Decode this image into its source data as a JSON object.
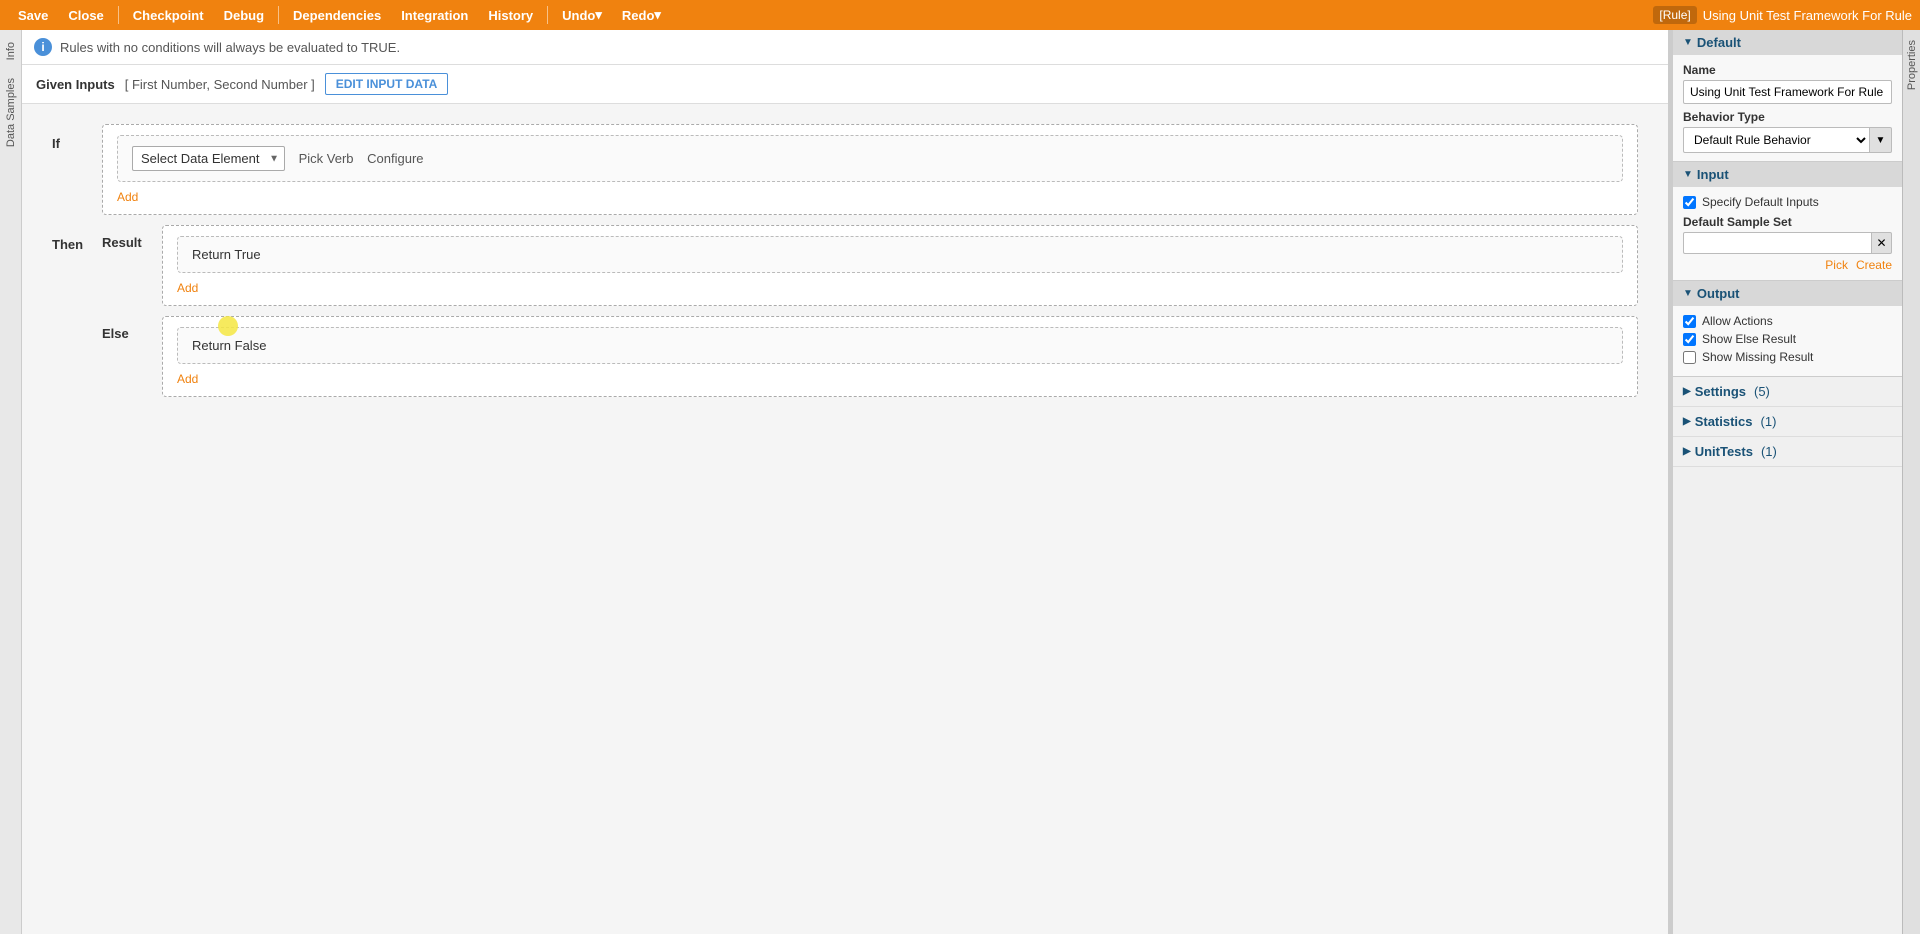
{
  "toolbar": {
    "save_label": "Save",
    "close_label": "Close",
    "checkpoint_label": "Checkpoint",
    "debug_label": "Debug",
    "dependencies_label": "Dependencies",
    "integration_label": "Integration",
    "history_label": "History",
    "undo_label": "Undo",
    "redo_label": "Redo",
    "rule_tag": "[Rule]",
    "breadcrumb_title": "Using Unit Test Framework For Rule"
  },
  "left_tabs": {
    "info_label": "Info",
    "data_samples_label": "Data Samples"
  },
  "info_bar": {
    "message": "Rules with no conditions will always be evaluated to TRUE."
  },
  "inputs_bar": {
    "given_inputs_label": "Given Inputs",
    "inputs_values": "[ First Number, Second Number ]",
    "edit_button_label": "EDIT INPUT DATA"
  },
  "rule": {
    "if_label": "If",
    "then_label": "Then",
    "else_label": "Else",
    "result_label": "Result",
    "select_placeholder": "Select Data Element",
    "pick_verb_label": "Pick Verb",
    "configure_label": "Configure",
    "add_label": "Add",
    "return_true_label": "Return True",
    "return_false_label": "Return False"
  },
  "right_panel": {
    "properties_tab": "Properties",
    "default_section": {
      "header": "Default",
      "name_label": "Name",
      "name_value": "Using Unit Test Framework For Rule",
      "behavior_type_label": "Behavior Type",
      "behavior_type_value": "Default Rule Behavior"
    },
    "input_section": {
      "header": "Input",
      "specify_inputs_label": "Specify Default Inputs",
      "specify_inputs_checked": true,
      "default_sample_set_label": "Default Sample Set",
      "sample_set_value": "",
      "pick_link": "Pick",
      "create_link": "Create"
    },
    "output_section": {
      "header": "Output",
      "allow_actions_label": "Allow Actions",
      "allow_actions_checked": true,
      "show_else_result_label": "Show Else Result",
      "show_else_result_checked": true,
      "show_missing_result_label": "Show Missing Result",
      "show_missing_result_checked": false
    },
    "settings_section": {
      "header": "Settings",
      "count": "(5)"
    },
    "statistics_section": {
      "header": "Statistics",
      "count": "(1)"
    },
    "unit_tests_section": {
      "header": "UnitTests",
      "count": "(1)"
    }
  }
}
